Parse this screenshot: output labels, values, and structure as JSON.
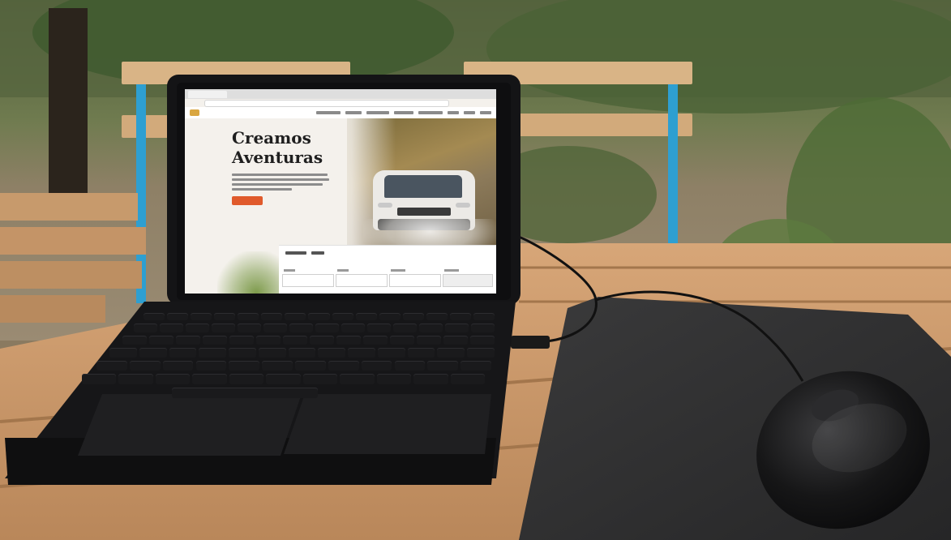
{
  "screen": {
    "hero": {
      "title_line1": "Creamos",
      "title_line2": "Aventuras"
    }
  },
  "colors": {
    "accent_button": "#e05a2b",
    "laptop_body": "#141416",
    "mousepad": "#2f2f30",
    "table_wood": "#c89668",
    "chair_frame": "#2e9fd1"
  },
  "objects": [
    "laptop",
    "keyboard",
    "touchpad",
    "usb-cable",
    "mouse",
    "mousepad",
    "wooden-table",
    "garden-chair",
    "garden-background"
  ]
}
